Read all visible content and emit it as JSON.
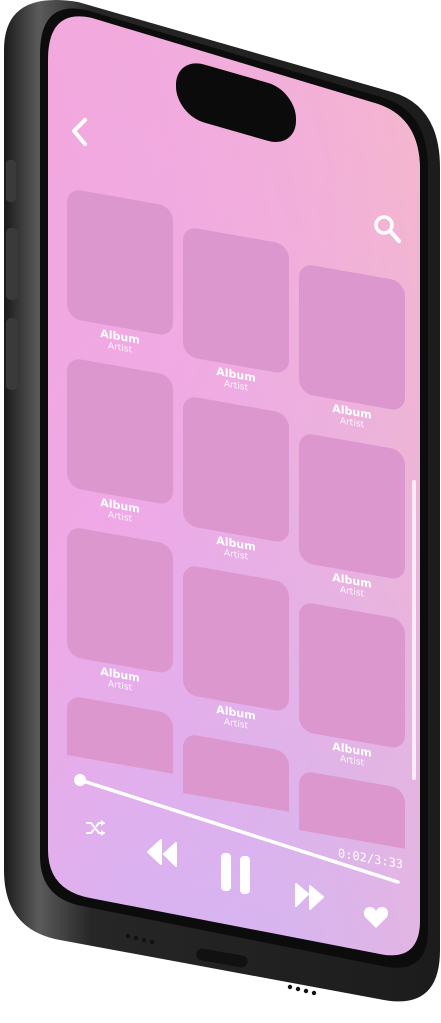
{
  "colors": {
    "screen_gradient_start": "#f0a6df",
    "screen_gradient_end": "#d8b6f6",
    "tile": "#dc97cf",
    "frame": "#2b2b2b",
    "text": "#ffffff"
  },
  "header": {
    "back_icon": "chevron-left-icon",
    "search_icon": "search-icon"
  },
  "albums": [
    {
      "title": "Album",
      "artist": "Artist"
    },
    {
      "title": "Album",
      "artist": "Artist"
    },
    {
      "title": "Album",
      "artist": "Artist"
    },
    {
      "title": "Album",
      "artist": "Artist"
    },
    {
      "title": "Album",
      "artist": "Artist"
    },
    {
      "title": "Album",
      "artist": "Artist"
    },
    {
      "title": "Album",
      "artist": "Artist"
    },
    {
      "title": "Album",
      "artist": "Artist"
    },
    {
      "title": "Album",
      "artist": "Artist"
    }
  ],
  "player": {
    "progress": 0.01,
    "time_label": "0:02/3:33",
    "shuffle_icon": "shuffle-icon",
    "rewind_icon": "rewind-icon",
    "pause_icon": "pause-icon",
    "forward_icon": "fast-forward-icon",
    "favorite_icon": "heart-icon"
  }
}
